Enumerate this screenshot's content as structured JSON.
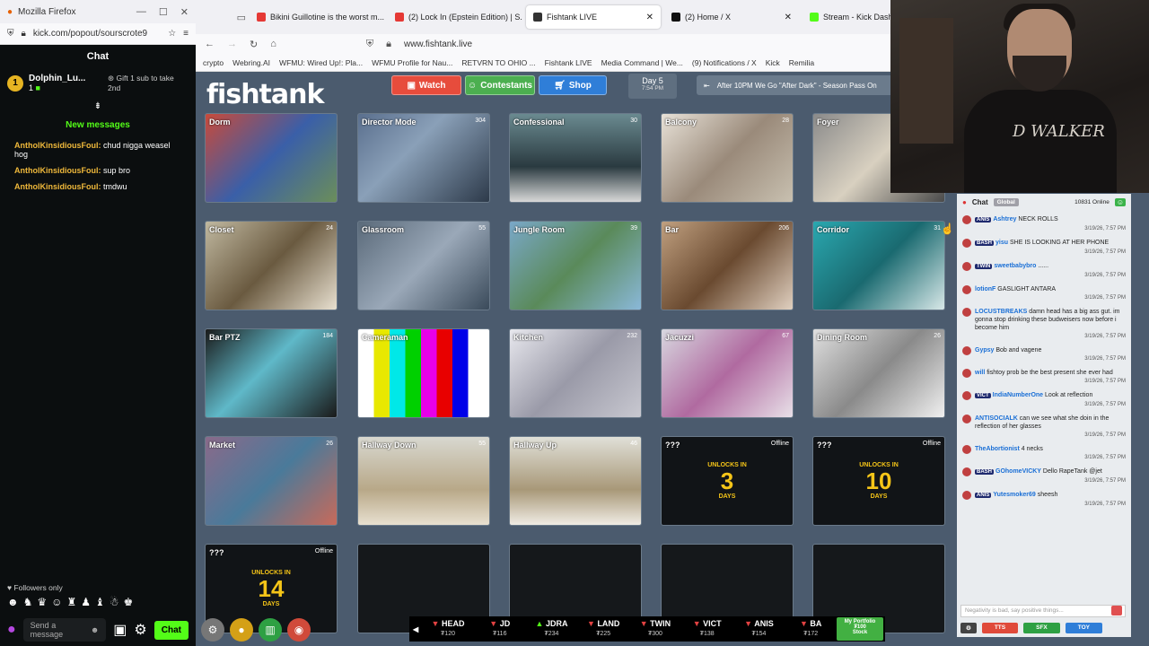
{
  "left_window": {
    "app_title": "Mozilla Firefox",
    "url": "kick.com/popout/sourscrote9",
    "chat_title": "Chat",
    "gifter": {
      "name": "Dolphin_Lu...",
      "rank": "1",
      "count": "1",
      "gift_text": "Gift 1 sub to take 2nd"
    },
    "new_messages": "New messages",
    "messages": [
      {
        "user": "AntholKinsidiousFoul:",
        "text": "chud nigga weasel hog"
      },
      {
        "user": "AntholKinsidiousFoul:",
        "text": "sup bro"
      },
      {
        "user": "AntholKinsidiousFoul:",
        "text": "tmdwu"
      }
    ],
    "followers_only": "Followers only",
    "send_placeholder": "Send a message",
    "chat_button": "Chat"
  },
  "browser": {
    "tabs": [
      {
        "label": "Bikini Guillotine is the worst m...",
        "color": "#e53935",
        "active": false
      },
      {
        "label": "(2) Lock In (Epstein Edition) | S...",
        "color": "#e53935",
        "active": false
      },
      {
        "label": "Fishtank LIVE",
        "color": "#333333",
        "active": true
      },
      {
        "label": "(2) Home / X",
        "color": "#111111",
        "active": false
      },
      {
        "label": "Stream - Kick Dashboard",
        "color": "#53fc18",
        "active": false
      }
    ],
    "address": "www.fishtank.live",
    "bookmarks": [
      "crypto",
      "Webring.AI",
      "WFMU: Wired Up!: Pla...",
      "WFMU Profile for Nau...",
      "RETVRN TO OHIO ...",
      "Fishtank LIVE",
      "Media Command | We...",
      "(9) Notifications / X",
      "Kick",
      "Remilia"
    ]
  },
  "site": {
    "logo": "fishtank",
    "nav": {
      "watch": "Watch",
      "contestants": "Contestants",
      "shop": "Shop"
    },
    "day": "Day 5",
    "time": "7:54 PM",
    "promo": "After 10PM We Go \"After Dark\" - Season Pass On",
    "cams": [
      {
        "label": "Dorm",
        "count": ""
      },
      {
        "label": "Director Mode",
        "count": "304"
      },
      {
        "label": "Confessional",
        "count": "30"
      },
      {
        "label": "Balcony",
        "count": "28"
      },
      {
        "label": "Foyer",
        "count": ""
      },
      {
        "label": "Closet",
        "count": "24"
      },
      {
        "label": "Glassroom",
        "count": "55"
      },
      {
        "label": "Jungle Room",
        "count": "39"
      },
      {
        "label": "Bar",
        "count": "206"
      },
      {
        "label": "Corridor",
        "count": "31"
      },
      {
        "label": "Bar PTZ",
        "count": "184"
      },
      {
        "label": "Cameraman",
        "count": "34"
      },
      {
        "label": "Kitchen",
        "count": "232"
      },
      {
        "label": "Jacuzzi",
        "count": "67"
      },
      {
        "label": "Dining Room",
        "count": "26"
      },
      {
        "label": "Market",
        "count": "26"
      },
      {
        "label": "Hallway Down",
        "count": "55"
      },
      {
        "label": "Hallway Up",
        "count": "46"
      }
    ],
    "locked": [
      {
        "label": "???",
        "status": "Offline",
        "unlocks": "UNLOCKS IN",
        "num": "3",
        "unit": "DAYS"
      },
      {
        "label": "???",
        "status": "Offline",
        "unlocks": "UNLOCKS IN",
        "num": "10",
        "unit": "DAYS"
      },
      {
        "label": "???",
        "status": "Offline",
        "unlocks": "UNLOCKS IN",
        "num": "14",
        "unit": "DAYS"
      }
    ],
    "ticker": [
      {
        "name": "HEAD",
        "value": "₮120",
        "dir": "dn"
      },
      {
        "name": "JD",
        "value": "₮116",
        "dir": "dn"
      },
      {
        "name": "JDRA",
        "value": "₮234",
        "dir": "up"
      },
      {
        "name": "LAND",
        "value": "₮225",
        "dir": "dn"
      },
      {
        "name": "TWIN",
        "value": "₮300",
        "dir": "dn"
      },
      {
        "name": "VICT",
        "value": "₮138",
        "dir": "dn"
      },
      {
        "name": "ANIS",
        "value": "₮154",
        "dir": "dn"
      },
      {
        "name": "BA",
        "value": "₮172",
        "dir": "dn"
      }
    ],
    "portfolio": {
      "label": "My Portfolio",
      "value": "₮100",
      "stock": "Stock"
    }
  },
  "side_chat": {
    "title": "Chat",
    "global": "Global",
    "online": "10831 Online",
    "messages": [
      {
        "tag": "ANIS",
        "user": "Ashtrey",
        "text": "NECK ROLLS",
        "time": "3/19/26, 7:57 PM"
      },
      {
        "tag": "BASH",
        "user": "yisu",
        "text": "SHE IS LOOKING AT HER PHONE",
        "time": "3/19/26, 7:57 PM"
      },
      {
        "tag": "TWIN",
        "user": "sweetbabybro",
        "text": "......",
        "time": "3/19/26, 7:57 PM"
      },
      {
        "tag": "",
        "user": "lotionF",
        "text": "GASLIGHT ANTARA",
        "time": "3/19/26, 7:57 PM"
      },
      {
        "tag": "",
        "user": "LOCUSTBREAKS",
        "text": "damn head has a big ass gut. im gonna stop drinking these budweisers now before i become him",
        "time": "3/19/26, 7:57 PM"
      },
      {
        "tag": "",
        "user": "Gypsy",
        "text": "Bob and vagene",
        "time": "3/19/26, 7:57 PM"
      },
      {
        "tag": "",
        "user": "will",
        "text": "fishtoy prob be the best present she ever had",
        "time": "3/19/26, 7:57 PM"
      },
      {
        "tag": "VICT",
        "user": "IndiaNumberOne",
        "text": "Look at reflection",
        "time": "3/19/26, 7:57 PM"
      },
      {
        "tag": "",
        "user": "ANTISOCIALK",
        "text": "can we see what she doin in the reflection of her glasses",
        "time": "3/19/26, 7:57 PM"
      },
      {
        "tag": "",
        "user": "TheAbortionist",
        "text": "4 necks",
        "time": "3/19/26, 7:57 PM"
      },
      {
        "tag": "BASH",
        "user": "GOhomeVICKY",
        "text": "Dello RapeTank @jet",
        "time": "3/19/26, 7:57 PM"
      },
      {
        "tag": "ANIS",
        "user": "Yutesmoker69",
        "text": "sheesh",
        "time": "3/19/26, 7:57 PM"
      }
    ],
    "input_placeholder": "Negativity is bad, say positive things...",
    "buttons": [
      "TTS",
      "SFX",
      "TOY"
    ]
  },
  "webcam": {
    "shirt_text": "D WALKER"
  }
}
